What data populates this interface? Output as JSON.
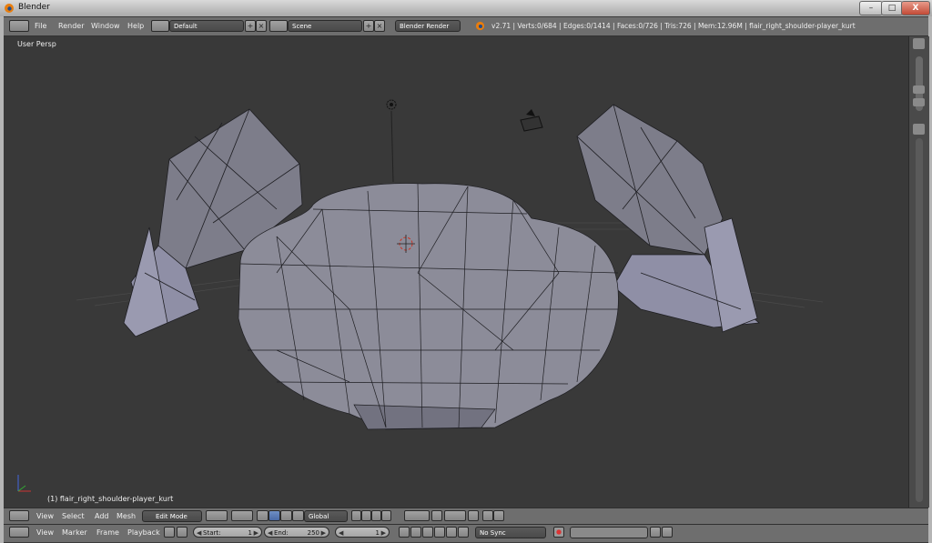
{
  "window": {
    "title": "Blender",
    "minimize": "–",
    "maximize": "□",
    "close": "X"
  },
  "info_header": {
    "menus": [
      "File",
      "Render",
      "Window",
      "Help"
    ],
    "screen_layout": "Default",
    "scene": "Scene",
    "render_engine": "Blender Render",
    "stats": "v2.71 | Verts:0/684 | Edges:0/1414 | Faces:0/726 | Tris:726 | Mem:12.96M | flair_right_shoulder-player_kurt"
  },
  "viewport": {
    "view_label": "User Persp",
    "object_label": "(1) flair_right_shoulder-player_kurt"
  },
  "view3d_header": {
    "menus": [
      "View",
      "Select",
      "Add",
      "Mesh"
    ],
    "mode": "Edit Mode",
    "orientation": "Global"
  },
  "timeline": {
    "menus": [
      "View",
      "Marker",
      "Frame",
      "Playback"
    ],
    "start_label": "Start:",
    "start_value": "1",
    "end_label": "End:",
    "end_value": "250",
    "current_frame": "1",
    "sync": "No Sync"
  },
  "colors": {
    "header_bg": "#6e6e6e",
    "viewport_bg": "#393939",
    "mesh_face": "#8a8a96",
    "grid": "#4a4a4a",
    "accent_blue": "#4a6aa6"
  }
}
